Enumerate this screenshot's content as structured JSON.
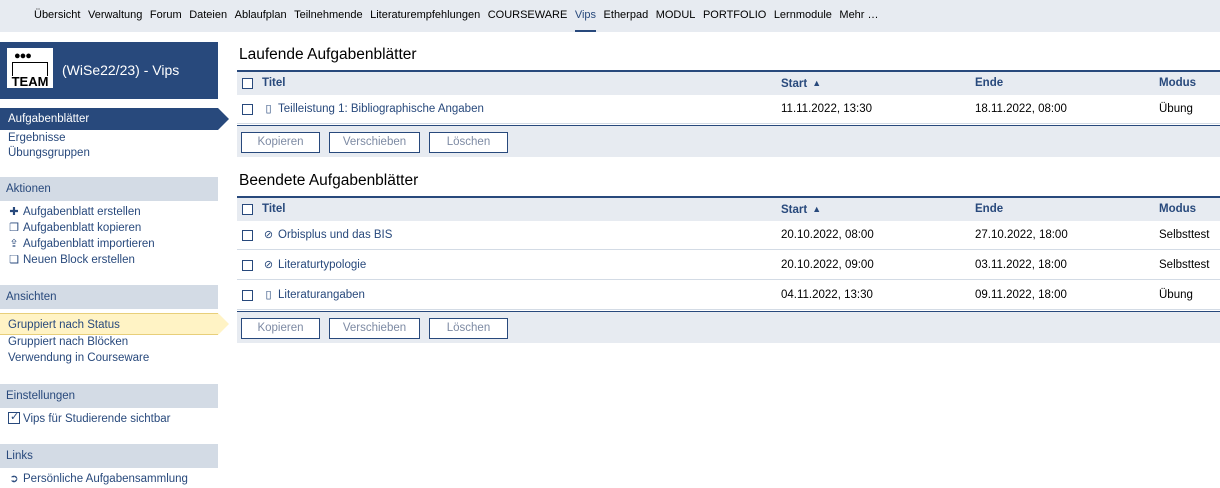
{
  "nav": {
    "items": [
      "Übersicht",
      "Verwaltung",
      "Forum",
      "Dateien",
      "Ablaufplan",
      "Teilnehmende",
      "Literaturempfehlungen",
      "COURSEWARE",
      "Vips",
      "Etherpad",
      "MODUL",
      "PORTFOLIO",
      "Lernmodule",
      "Mehr …"
    ],
    "active_index": 8
  },
  "context": {
    "logo_text": "TEAM",
    "title": "(WiSe22/23) - Vips"
  },
  "sidebar": {
    "main_items": [
      "Aufgabenblätter",
      "Ergebnisse",
      "Übungsgruppen"
    ],
    "actions_header": "Aktionen",
    "actions": [
      {
        "icon": "plus-icon",
        "label": "Aufgabenblatt erstellen"
      },
      {
        "icon": "copy-icon",
        "label": "Aufgabenblatt kopieren"
      },
      {
        "icon": "import-icon",
        "label": "Aufgabenblatt importieren"
      },
      {
        "icon": "new-block-icon",
        "label": "Neuen Block erstellen"
      }
    ],
    "views_header": "Ansichten",
    "views": [
      "Gruppiert nach Status",
      "Gruppiert nach Blöcken",
      "Verwendung in Courseware"
    ],
    "settings_header": "Einstellungen",
    "settings_checkbox": "Vips für Studierende sichtbar",
    "links_header": "Links",
    "links": [
      {
        "icon": "circle-arrow-icon",
        "label": "Persönliche Aufgabensammlung"
      }
    ]
  },
  "columns": {
    "title": "Titel",
    "start": "Start",
    "end": "Ende",
    "mode": "Modus"
  },
  "running": {
    "heading": "Laufende Aufgabenblätter",
    "rows": [
      {
        "icon": "document-icon",
        "title": "Teilleistung 1: Bibliographische Angaben",
        "start": "11.11.2022, 13:30",
        "end": "18.11.2022, 08:00",
        "mode": "Übung"
      }
    ]
  },
  "finished": {
    "heading": "Beendete Aufgabenblätter",
    "rows": [
      {
        "icon": "check-circle-icon",
        "title": "Orbisplus und das BIS",
        "start": "20.10.2022, 08:00",
        "end": "27.10.2022, 18:00",
        "mode": "Selbsttest"
      },
      {
        "icon": "check-circle-icon",
        "title": "Literaturtypologie",
        "start": "20.10.2022, 09:00",
        "end": "03.11.2022, 18:00",
        "mode": "Selbsttest"
      },
      {
        "icon": "document-icon",
        "title": "Literaturangaben",
        "start": "04.11.2022, 13:30",
        "end": "09.11.2022, 18:00",
        "mode": "Übung"
      }
    ]
  },
  "buttons": {
    "copy": "Kopieren",
    "move": "Verschieben",
    "delete": "Löschen"
  },
  "colors": {
    "brand": "#28497c",
    "nav_bg": "#e7ebf1",
    "sidebar_header_bg": "#d3dbe5",
    "selected_view_bg": "#fff3c5"
  }
}
